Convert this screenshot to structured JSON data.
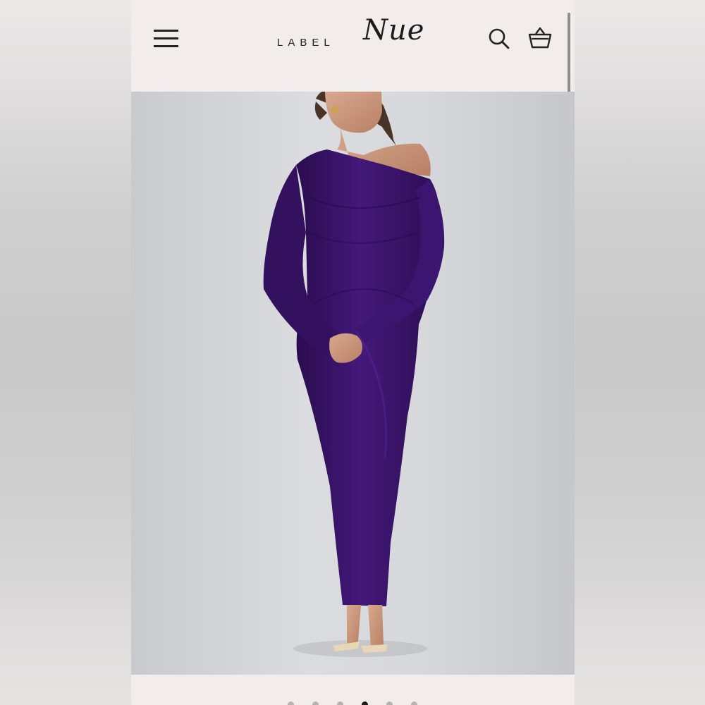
{
  "header": {
    "logo_word": "LABEL",
    "logo_script": "Nue"
  },
  "icons": {
    "menu": "hamburger-menu-icon",
    "search": "search-icon",
    "bag": "shopping-basket-icon"
  },
  "product_image": {
    "description_hidden": false,
    "dress_color": "#3a1466"
  },
  "carousel": {
    "total": 6,
    "active_index": 3
  },
  "colors": {
    "header_bg": "#f3ecec",
    "icon": "#222222"
  }
}
